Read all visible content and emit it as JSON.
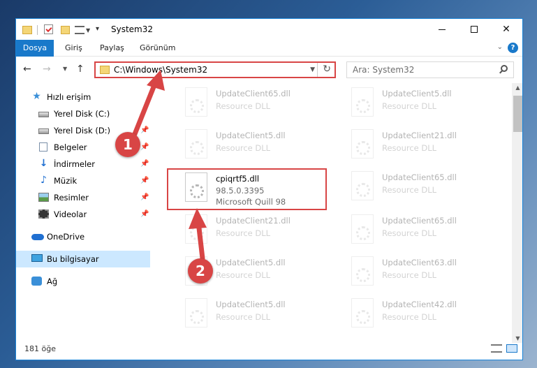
{
  "window": {
    "title": "System32"
  },
  "ribbon": {
    "tabs": [
      "Dosya",
      "Giriş",
      "Paylaş",
      "Görünüm"
    ]
  },
  "nav": {
    "address": "C:\\Windows\\System32",
    "search_placeholder": "Ara: System32"
  },
  "sidebar": {
    "items": [
      {
        "label": "Hızlı erişim",
        "icon": "star-icon",
        "pinned": false
      },
      {
        "label": "Yerel Disk (C:)",
        "icon": "drive-icon",
        "pinned": false
      },
      {
        "label": "Yerel Disk (D:)",
        "icon": "drive-icon",
        "pinned": true
      },
      {
        "label": "Belgeler",
        "icon": "documents-icon",
        "pinned": true
      },
      {
        "label": "İndirmeler",
        "icon": "downloads-icon",
        "pinned": true
      },
      {
        "label": "Müzik",
        "icon": "music-icon",
        "pinned": true
      },
      {
        "label": "Resimler",
        "icon": "pictures-icon",
        "pinned": true
      },
      {
        "label": "Videolar",
        "icon": "videos-icon",
        "pinned": true
      },
      {
        "label": "OneDrive",
        "icon": "onedrive-icon",
        "pinned": false
      },
      {
        "label": "Bu bilgisayar",
        "icon": "this-pc-icon",
        "pinned": false,
        "selected": true
      },
      {
        "label": "Ağ",
        "icon": "network-icon",
        "pinned": false
      }
    ]
  },
  "files": {
    "left": [
      {
        "name": "UpdateClient65.dll",
        "type": "Resource DLL"
      },
      {
        "name": "UpdateClient5.dll",
        "type": "Resource DLL"
      },
      {
        "name": "cpiqrtf5.dll",
        "version": "98.5.0.3395",
        "company": "Microsoft Quill 98",
        "highlighted": true
      },
      {
        "name": "UpdateClient21.dll",
        "type": "Resource DLL"
      },
      {
        "name": "UpdateClient5.dll",
        "type": "Resource DLL"
      },
      {
        "name": "UpdateClient5.dll",
        "type": "Resource DLL"
      }
    ],
    "right": [
      {
        "name": "UpdateClient5.dll",
        "type": "Resource DLL"
      },
      {
        "name": "UpdateClient21.dll",
        "type": "Resource DLL"
      },
      {
        "name": "UpdateClient65.dll",
        "type": "Resource DLL"
      },
      {
        "name": "UpdateClient65.dll",
        "type": "Resource DLL"
      },
      {
        "name": "UpdateClient63.dll",
        "type": "Resource DLL"
      },
      {
        "name": "UpdateClient42.dll",
        "type": "Resource DLL"
      }
    ]
  },
  "status": {
    "item_count": "181 öğe"
  },
  "callouts": [
    "1",
    "2"
  ],
  "colors": {
    "accent": "#1979ca",
    "highlight": "#d84545",
    "selection": "#cce8ff"
  }
}
